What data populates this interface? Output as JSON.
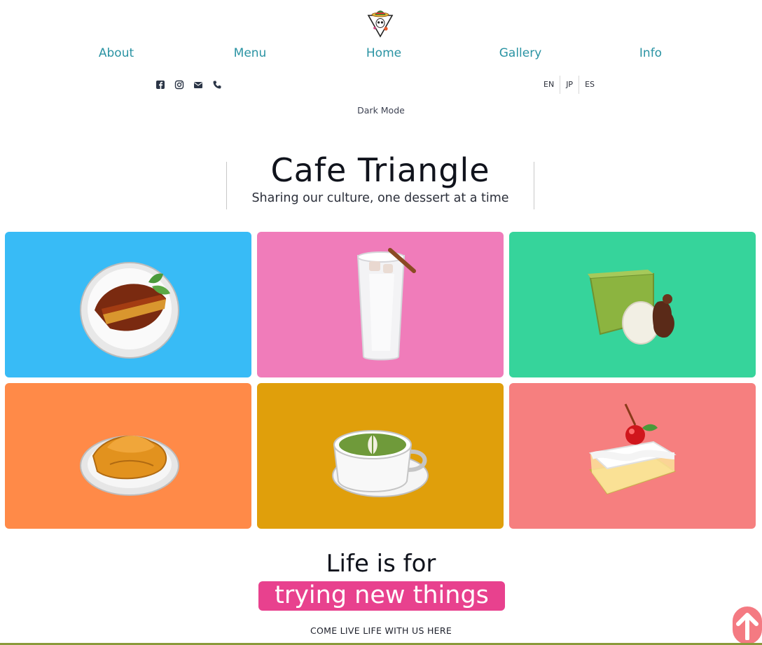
{
  "nav": {
    "items": [
      {
        "label": "About"
      },
      {
        "label": "Menu"
      },
      {
        "label": "Home"
      },
      {
        "label": "Gallery"
      },
      {
        "label": "Info"
      }
    ]
  },
  "social": [
    "facebook-icon",
    "instagram-icon",
    "envelope-icon",
    "phone-icon"
  ],
  "languages": [
    "EN",
    "JP",
    "ES"
  ],
  "dark_mode_label": "Dark Mode",
  "hero": {
    "title": "Cafe Triangle",
    "subtitle": "Sharing our culture, one dessert at a time"
  },
  "gallery": {
    "tiles": [
      {
        "item": "flan-slice",
        "color": "#38bbf6"
      },
      {
        "item": "iced-horchata",
        "color": "#f07cba"
      },
      {
        "item": "matcha-cake",
        "color": "#36d49b"
      },
      {
        "item": "taiyaki",
        "color": "#ff8a48"
      },
      {
        "item": "matcha-latte",
        "color": "#e09f0b"
      },
      {
        "item": "tres-leches-cake",
        "color": "#f67f7f"
      }
    ]
  },
  "tagline": {
    "line1": "Life is for",
    "line2": "trying new things",
    "cta": "COME LIVE LIFE WITH US HERE"
  },
  "colors": {
    "nav_link": "#2a93a3",
    "highlight": "#e8418e",
    "scroll_button": "#f47a82"
  }
}
